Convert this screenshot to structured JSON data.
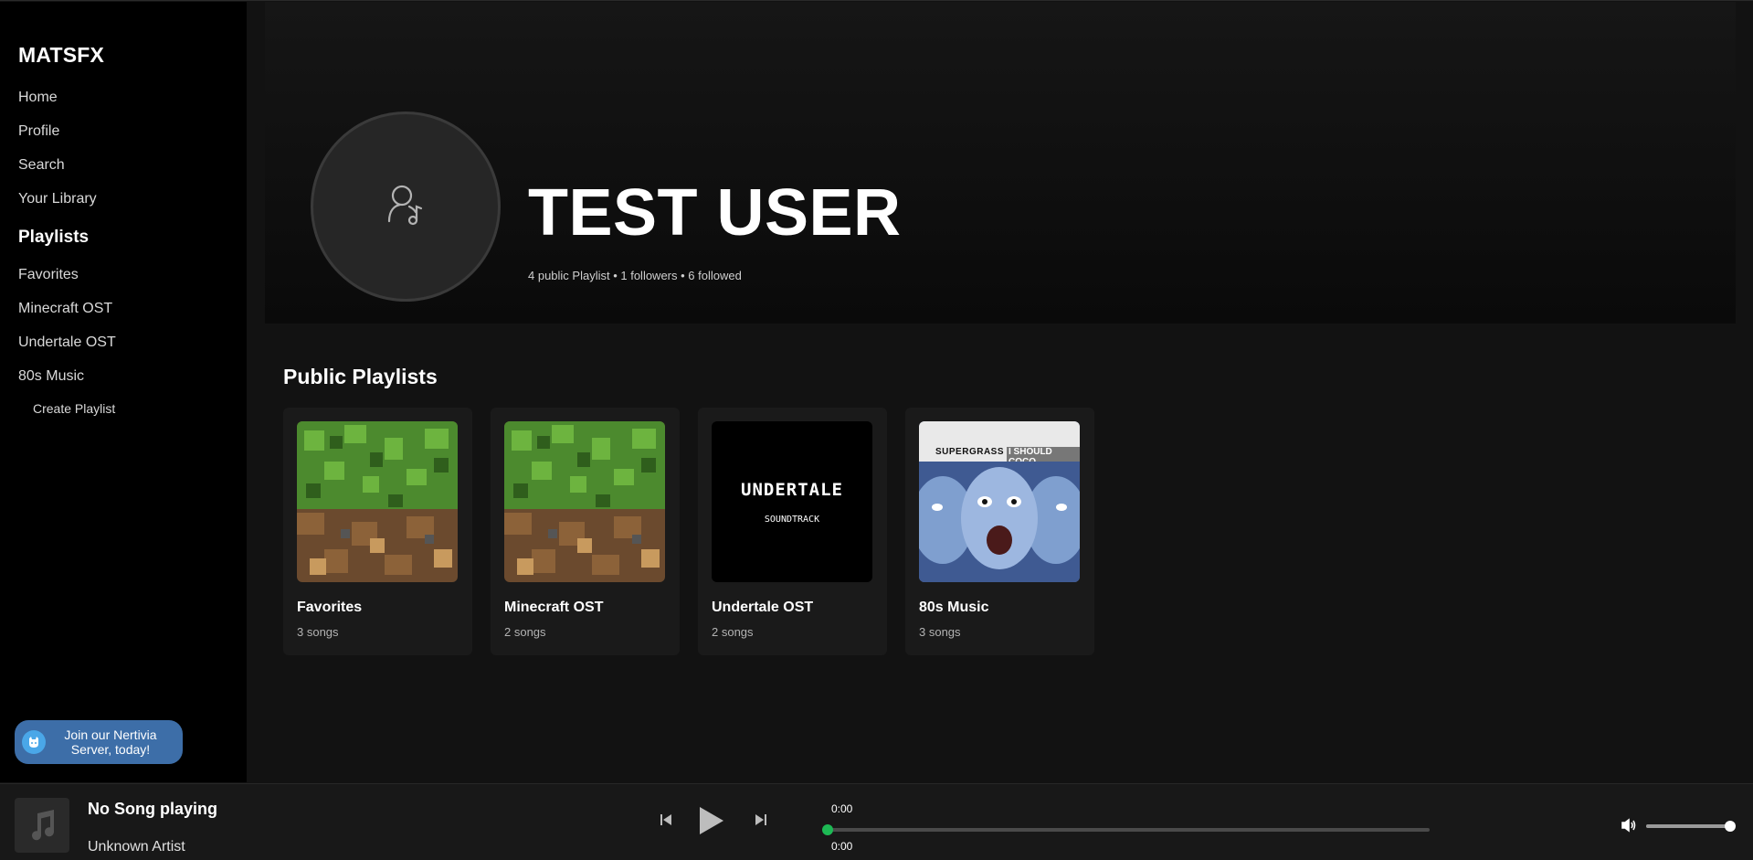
{
  "sidebar": {
    "brand": "MATSFX",
    "nav": [
      {
        "label": "Home"
      },
      {
        "label": "Profile"
      },
      {
        "label": "Search"
      },
      {
        "label": "Your Library"
      }
    ],
    "playlists_heading": "Playlists",
    "playlists": [
      {
        "label": "Favorites"
      },
      {
        "label": "Minecraft OST"
      },
      {
        "label": "Undertale OST"
      },
      {
        "label": "80s Music"
      }
    ],
    "create_label": "Create Playlist",
    "join_button": {
      "line1": "Join our Nertivia",
      "line2": "Server, today!",
      "icon": "nertivia-icon"
    }
  },
  "profile": {
    "name": "TEST USER",
    "stats": "4 public Playlist • 1 followers • 6 followed",
    "avatar_icon": "user-music-icon"
  },
  "public_playlists": {
    "title": "Public Playlists",
    "items": [
      {
        "name": "Favorites",
        "count": "3 songs",
        "cover": "minecraft-cover"
      },
      {
        "name": "Minecraft OST",
        "count": "2 songs",
        "cover": "minecraft-cover"
      },
      {
        "name": "Undertale OST",
        "count": "2 songs",
        "cover": "undertale-cover"
      },
      {
        "name": "80s Music",
        "count": "3 songs",
        "cover": "supergrass-cover"
      }
    ],
    "undertale_cover_title": "UNDERTALE",
    "undertale_cover_sub": "SOUNDTRACK",
    "supergrass_cover_title": "SUPERGRASS",
    "supergrass_cover_sub": "I SHOULD COCO"
  },
  "player": {
    "title": "No Song playing",
    "artist": "Unknown Artist",
    "current_time": "0:00",
    "duration": "0:00",
    "progress": 0,
    "volume": 1.0,
    "colors": {
      "accent": "#1db954",
      "bg": "#181818"
    }
  }
}
